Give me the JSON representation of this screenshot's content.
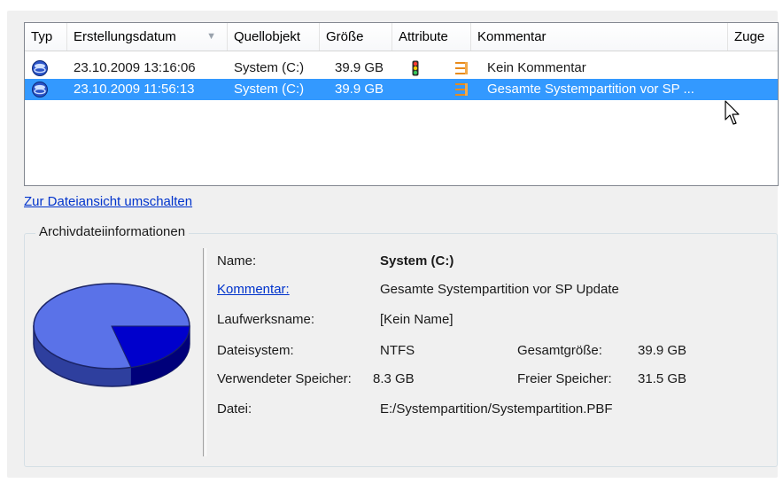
{
  "listview": {
    "columns": [
      {
        "label": "Typ"
      },
      {
        "label": "Erstellungsdatum"
      },
      {
        "label": "Quellobjekt"
      },
      {
        "label": "Größe"
      },
      {
        "label": "Attribute"
      },
      {
        "label": "Kommentar"
      },
      {
        "label": "Zuge"
      }
    ],
    "rows": [
      {
        "date": "23.10.2009 13:16:06",
        "source": "System (C:)",
        "size": "39.9 GB",
        "attributes": [
          "lock-icon",
          "archive-icon"
        ],
        "comment": "Kein Kommentar",
        "selected": false
      },
      {
        "date": "23.10.2009 11:56:13",
        "source": "System (C:)",
        "size": "39.9 GB",
        "attributes": [
          "archive-icon"
        ],
        "comment": "Gesamte Systempartition vor SP ...",
        "selected": true
      }
    ]
  },
  "switch_view_link": "Zur Dateiansicht umschalten",
  "archive_info": {
    "title": "Archivdateiinformationen",
    "labels": {
      "name": "Name:",
      "comment": "Kommentar:",
      "drive_name": "Laufwerksname:",
      "filesystem": "Dateisystem:",
      "used": "Verwendeter Speicher:",
      "file": "Datei:",
      "total": "Gesamtgröße:",
      "free": "Freier Speicher:"
    },
    "values": {
      "name": "System (C:)",
      "comment": "Gesamte Systempartition vor SP Update",
      "drive_name": "[Kein Name]",
      "filesystem": "NTFS",
      "used": "8.3 GB",
      "file": "E:/Systempartition/Systempartition.PBF",
      "total": "39.9 GB",
      "free": "31.5 GB"
    },
    "pie": {
      "used_fraction": 0.21,
      "used_color": "#0000cc",
      "free_color": "#5a72e8"
    }
  },
  "colors": {
    "selection": "#3399ff",
    "link": "#0033cc"
  }
}
